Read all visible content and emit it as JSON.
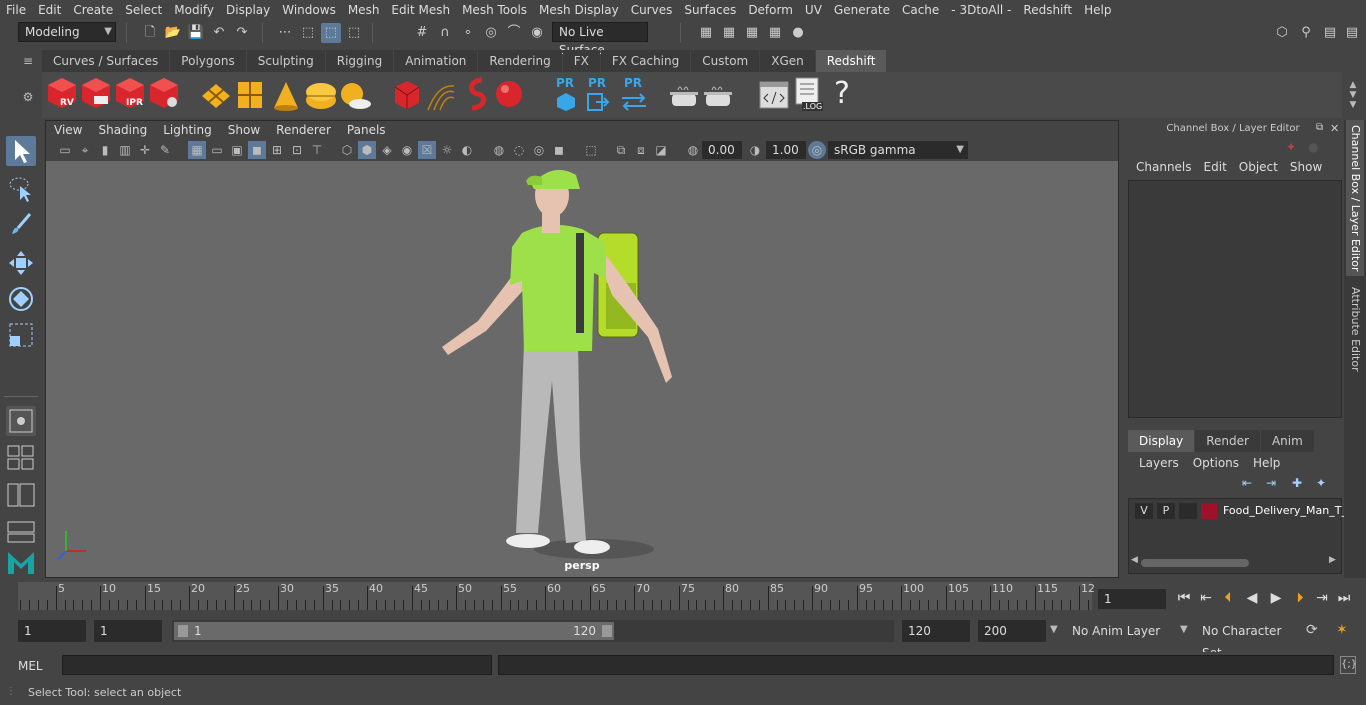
{
  "menubar": {
    "items": [
      "File",
      "Edit",
      "Create",
      "Select",
      "Modify",
      "Display",
      "Windows",
      "Mesh",
      "Edit Mesh",
      "Mesh Tools",
      "Mesh Display",
      "Curves",
      "Surfaces",
      "Deform",
      "UV",
      "Generate",
      "Cache",
      "- 3DtoAll -",
      "Redshift",
      "Help"
    ]
  },
  "statusline": {
    "workspace": "Modeling",
    "live_surface": "No Live Surface"
  },
  "shelf": {
    "tabs": [
      "Curves / Surfaces",
      "Polygons",
      "Sculpting",
      "Rigging",
      "Animation",
      "Rendering",
      "FX",
      "FX Caching",
      "Custom",
      "XGen",
      "Redshift"
    ],
    "active_tab": "Redshift",
    "buttons": [
      {
        "label": "RV"
      },
      {
        "label": ""
      },
      {
        "label": "IPR"
      },
      {
        "label": ""
      },
      {
        "label": "PR"
      },
      {
        "label": "PR"
      },
      {
        "label": "PR"
      },
      {
        "label": ".LOG"
      },
      {
        "label": "?"
      }
    ]
  },
  "viewport": {
    "menu": [
      "View",
      "Shading",
      "Lighting",
      "Show",
      "Renderer",
      "Panels"
    ],
    "exposure": "0.00",
    "gamma": "1.00",
    "colorspace": "sRGB gamma",
    "camera_label": "persp",
    "bg_color": "#696969"
  },
  "channelbox": {
    "title": "Channel Box / Layer Editor",
    "menu": [
      "Channels",
      "Edit",
      "Object",
      "Show"
    ],
    "layer_tabs": [
      "Display",
      "Render",
      "Anim"
    ],
    "active_layer_tab": "Display",
    "layer_menu": [
      "Layers",
      "Options",
      "Help"
    ],
    "layers": [
      {
        "v": "V",
        "p": "P",
        "name": "Food_Delivery_Man_T_",
        "color": "#a0102a"
      }
    ]
  },
  "sidetabs": [
    "Channel Box / Layer Editor",
    "Attribute Editor"
  ],
  "timeline": {
    "ticks": [
      "5",
      "10",
      "15",
      "20",
      "25",
      "30",
      "35",
      "40",
      "45",
      "50",
      "55",
      "60",
      "65",
      "70",
      "75",
      "80",
      "85",
      "90",
      "95",
      "100",
      "105",
      "110",
      "115",
      "12"
    ],
    "start_label": "1",
    "current_frame": "1"
  },
  "range": {
    "start": "1",
    "playback_start": "1",
    "range_start": "1",
    "range_end": "120",
    "playback_end": "120",
    "end": "200",
    "anim_layer": "No Anim Layer",
    "character_set": "No Character Set"
  },
  "cmdline": {
    "lang": "MEL"
  },
  "helpline": {
    "text": "Select Tool: select an object"
  }
}
